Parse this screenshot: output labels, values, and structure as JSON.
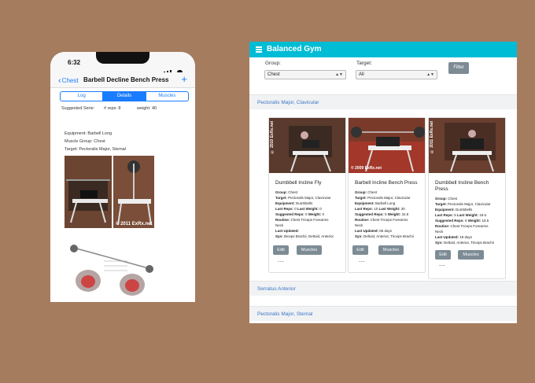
{
  "phone": {
    "time": "6:32",
    "back_label": "Chest",
    "title": "Barbell Decline Bench Press",
    "add_label": "+",
    "tabs": [
      "Log",
      "Details",
      "Muscles"
    ],
    "active_tab": "Details",
    "suggested_serie_label": "Suggested Serie:",
    "reps_label": "# reps: 8",
    "weight_label": "weight: 40",
    "equipment": "Equipment:  Barbell Long",
    "muscle_group": "Muscle Group:   Chest",
    "target": "Target:  Pectoralis Major, Sternal",
    "image_watermark": "© 2011 ExRx.net"
  },
  "web": {
    "app_title": "Balanced Gym",
    "group_label": "Group:",
    "group_value": "Chest",
    "target_label": "Target:",
    "target_value": "All",
    "filter_label": "Filter",
    "sections": [
      "Pectoralis Major, Clavicular",
      "Serratus Anterior",
      "Pectoralis Major, Sternal"
    ],
    "cards": [
      {
        "title": "Dumbbell Incline Fly",
        "watermark": "© 2010 ExRx.net",
        "group": "Chest",
        "target": "Pectoralis Major, Clavicular",
        "equipment": "Dumbbells",
        "last_reps": "0",
        "last_weight": "0",
        "suggested_reps": "0",
        "suggested_weight": "0",
        "routine": "Chest Triceps Forearms",
        "routine_cont": "Neck",
        "last_updated": "",
        "syn": "Biceps Brachii, Deltoid, Anterior"
      },
      {
        "title": "Barbell Incline Bench Press",
        "watermark": "© 2009 ExRx.net",
        "group": "Chest",
        "target": "Pectoralis Major, Clavicular",
        "equipment": "Barbell Long",
        "last_reps": "10",
        "last_weight": "30",
        "suggested_reps": "5",
        "suggested_weight": "32.8",
        "routine": "Chest Triceps Forearms",
        "routine_cont": "Neck",
        "last_updated": "66 days",
        "syn": "Deltoid, Anterior, Triceps Brachii"
      },
      {
        "title": "Dumbbell Incline Bench Press",
        "watermark": "© 2011 ExRx.net",
        "group": "Chest",
        "target": "Pectoralis Major, Clavicular",
        "equipment": "Dumbbells",
        "last_reps": "5",
        "last_weight": "18.5",
        "suggested_reps": "5",
        "suggested_weight": "18.5",
        "routine": "Chest Triceps Forearms",
        "routine_cont": "Neck",
        "last_updated": "18 days",
        "syn": "Deltoid, Anterior, Triceps Brachii"
      }
    ],
    "labels": {
      "group": "Group: ",
      "target": "Target: ",
      "equipment": "Equipment: ",
      "last_reps": "Last Reps: ",
      "last_weight": " Last Weight: ",
      "suggested_reps": "Suggested Reps: ",
      "suggested_weight": " Weight: ",
      "routine": "Routine: ",
      "last_updated": "Last Updated: ",
      "syn": "Syn: ",
      "edit": "Edit",
      "muscles": "Muscles",
      "more": "..."
    }
  }
}
